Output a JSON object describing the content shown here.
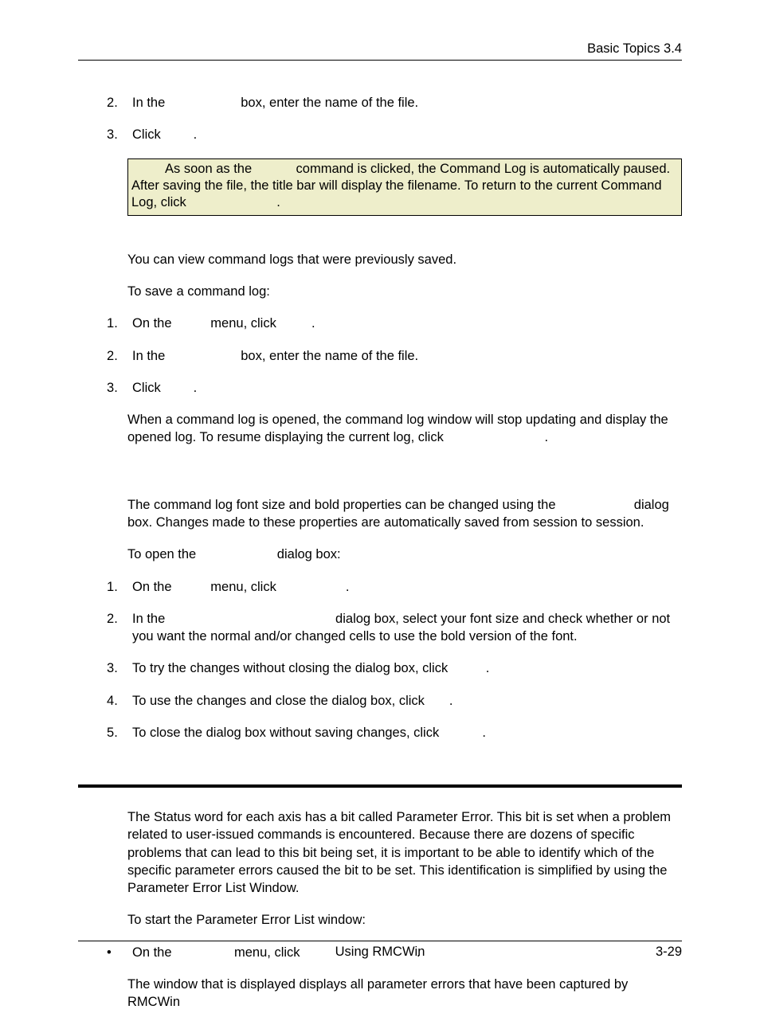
{
  "header": {
    "right": "Basic Topics  3.4"
  },
  "section1": {
    "item2": {
      "num": "2",
      "pre": "In the ",
      "gap_em": 5.2,
      "post": " box, enter the name of the file."
    },
    "item3": {
      "num": "3",
      "pre": "Click ",
      "gap_em": 2.2,
      "post": "."
    },
    "note_line1_pre": "As soon as the ",
    "note_line1_gap_em": 2.8,
    "note_line1_post": " command is clicked, the Command Log is automatically paused. After saving the file, the title bar will display the filename. To return to the current Command Log, click ",
    "note_end_gap_em": 6.6,
    "note_end_post": "."
  },
  "section2": {
    "para1": "You can view command logs that were previously saved.",
    "para2": "To save a command log:",
    "item1": {
      "num": "1",
      "pre": "On the ",
      "gap1_em": 2.4,
      "mid": " menu, click ",
      "gap2_em": 2.4,
      "post": "."
    },
    "item2": {
      "num": "2",
      "pre": "In the ",
      "gap_em": 5.2,
      "post": " box, enter the name of the file."
    },
    "item3": {
      "num": "3",
      "pre": "Click ",
      "gap_em": 2.2,
      "post": "."
    },
    "after_pre": "When a command log is opened, the command log window will stop updating and display the opened log. To resume displaying the current log, click ",
    "after_gap_em": 7.4,
    "after_post": "."
  },
  "section3": {
    "para1_pre": "The command log font size and bold properties can be changed using the ",
    "para1_gap_em": 5.4,
    "para1_post": " dialog box. Changes made to these properties are automatically saved from session to session.",
    "para2_pre": "To open the ",
    "para2_gap_em": 5.6,
    "para2_post": " dialog box:",
    "item1": {
      "num": "1",
      "pre": "On the ",
      "gap1_em": 2.4,
      "mid": " menu, click ",
      "gap2_em": 5.0,
      "post": "."
    },
    "item2": {
      "num": "2",
      "pre": "In the ",
      "gap_em": 12.4,
      "post": " dialog box, select your font size and check whether or not you want the normal and/or changed cells to use the bold version of the font."
    },
    "item3": {
      "num": "3",
      "pre": "To try the changes without closing the dialog box, click ",
      "gap_em": 2.6,
      "post": "."
    },
    "item4": {
      "num": "4",
      "pre": "To use the changes and close the dialog box, click ",
      "gap_em": 1.6,
      "post": "."
    },
    "item5": {
      "num": "5",
      "pre": "To close the dialog box without saving changes, click ",
      "gap_em": 3.0,
      "post": "."
    }
  },
  "section4": {
    "para1": "The Status word for each axis has a bit called Parameter Error. This bit is set when a problem related to user-issued commands is encountered. Because there are dozens of specific problems that can lead to this bit being set, it is important to be able to identify which of the specific parameter errors caused the bit to be set. This identification is simplified by using the Parameter Error List Window.",
    "para2": "To start the Parameter Error List window:",
    "bullet": {
      "pre": "On the ",
      "gap1_em": 4.2,
      "mid": " menu, click ",
      "gap2_em": 8.6,
      "post": "."
    },
    "para3": "The window that is displayed displays all parameter errors that have been captured by RMCWin"
  },
  "footer": {
    "center": "Using RMCWin",
    "right": "3-29"
  }
}
